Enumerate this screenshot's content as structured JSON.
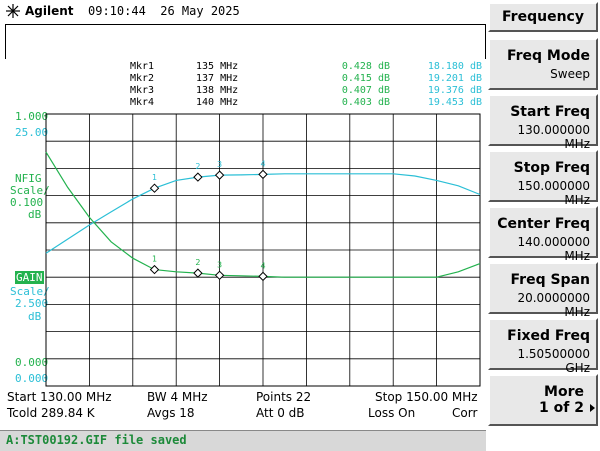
{
  "header": {
    "brand": "Agilent",
    "time": "09:10:44",
    "date": "26 May 2025"
  },
  "markers": [
    {
      "name": "Mkr1",
      "freq": "135 MHz",
      "nf": "0.428 dB",
      "gain": "18.180 dB"
    },
    {
      "name": "Mkr2",
      "freq": "137 MHz",
      "nf": "0.415 dB",
      "gain": "19.201 dB"
    },
    {
      "name": "Mkr3",
      "freq": "138 MHz",
      "nf": "0.407 dB",
      "gain": "19.376 dB"
    },
    {
      "name": "Mkr4",
      "freq": "140 MHz",
      "nf": "0.403 dB",
      "gain": "19.453 dB"
    }
  ],
  "left_scale": {
    "nf_top": "1.000",
    "gain_top": "25.00",
    "nf_label": "NFIG",
    "nf_scale_word": "Scale/",
    "nf_scale_val": "0.100",
    "nf_unit": "dB",
    "gain_label": "GAIN",
    "gain_scale_word": "Scale/",
    "gain_scale_val": "2.500",
    "gain_unit": "dB",
    "nf_bottom": "0.000",
    "gain_bottom": "0.000"
  },
  "chart_data": {
    "type": "line",
    "x": [
      130,
      131,
      132,
      133,
      134,
      135,
      136,
      137,
      138,
      139,
      140,
      141,
      142,
      143,
      144,
      145,
      146,
      147,
      148,
      149,
      150
    ],
    "series": [
      {
        "name": "GAIN",
        "axis": "gain",
        "color": "#2bbfd6",
        "values": [
          12.2,
          13.5,
          14.8,
          16.0,
          17.2,
          18.18,
          18.9,
          19.2,
          19.38,
          19.4,
          19.45,
          19.5,
          19.5,
          19.5,
          19.5,
          19.5,
          19.5,
          19.3,
          18.9,
          18.4,
          17.6
        ]
      },
      {
        "name": "NFIG",
        "axis": "nf",
        "color": "#23b24e",
        "values": [
          0.86,
          0.73,
          0.62,
          0.53,
          0.47,
          0.428,
          0.42,
          0.415,
          0.407,
          0.405,
          0.403,
          0.4,
          0.4,
          0.4,
          0.4,
          0.4,
          0.4,
          0.4,
          0.4,
          0.42,
          0.45
        ]
      }
    ],
    "nf_range": [
      0,
      1.0
    ],
    "gain_range": [
      0,
      25
    ],
    "marker_x": [
      135,
      137,
      138,
      140
    ],
    "marker_labels": [
      "1",
      "2",
      "3",
      "4"
    ],
    "grid": true
  },
  "footer": {
    "start": "Start 130.00 MHz",
    "bw": "BW 4 MHz",
    "points": "Points 22",
    "stop": "Stop 150.00 MHz",
    "tcold": "Tcold 289.84 K",
    "avgs": "Avgs 18",
    "att": "Att 0 dB",
    "loss": "Loss On",
    "corr": "Corr"
  },
  "status_text": "A:TST00192.GIF file saved",
  "softkeys": {
    "title": "Frequency",
    "items": [
      {
        "label": "Freq Mode",
        "value": "Sweep"
      },
      {
        "label": "Start Freq",
        "value": "130.000000 MHz"
      },
      {
        "label": "Stop Freq",
        "value": "150.000000 MHz"
      },
      {
        "label": "Center Freq",
        "value": "140.000000 MHz"
      },
      {
        "label": "Freq Span",
        "value": "20.0000000 MHz"
      },
      {
        "label": "Fixed Freq",
        "value": "1.50500000 GHz"
      },
      {
        "label": "More",
        "value": "1 of 2"
      }
    ]
  }
}
